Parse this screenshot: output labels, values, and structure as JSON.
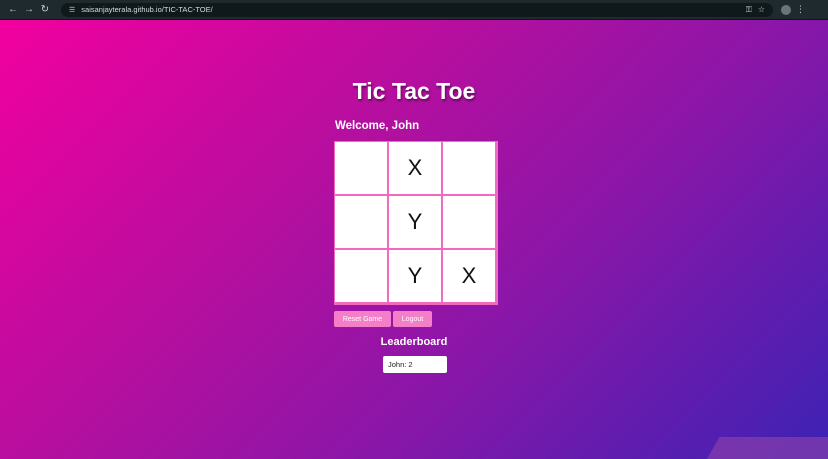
{
  "browser": {
    "url": "saisanjayterala.github.io/TIC-TAC-TOE/",
    "back_icon": "arrow-left-icon",
    "forward_icon": "arrow-right-icon",
    "reload_icon": "reload-icon"
  },
  "app": {
    "title": "Tic Tac Toe",
    "welcome": "Welcome, John"
  },
  "board": {
    "cells": [
      "",
      "X",
      "",
      "",
      "Y",
      "",
      "",
      "Y",
      "X"
    ]
  },
  "controls": {
    "reset_label": "Reset Game",
    "logout_label": "Logout"
  },
  "leaderboard": {
    "title": "Leaderboard",
    "entries": [
      "John: 2"
    ]
  },
  "colors": {
    "board_border": "#f06ac0",
    "button_bg": "#f57ec8",
    "gradient_start": "#f2009f",
    "gradient_end": "#3c22b4"
  }
}
